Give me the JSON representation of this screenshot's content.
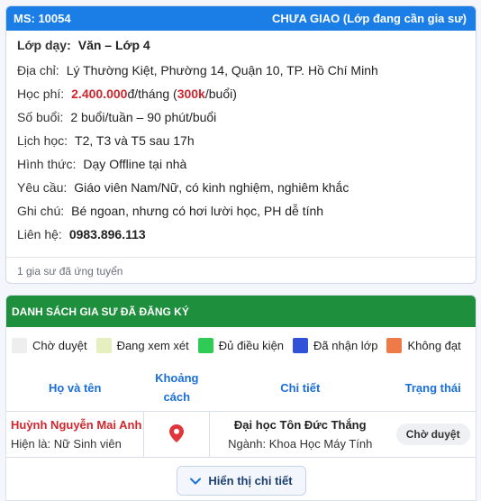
{
  "listing": {
    "code": "MS: 10054",
    "status": "CHƯA GIAO (Lớp đang cần gia sư)",
    "class_label": "Lớp dạy:",
    "class_value": "Văn – Lớp 4",
    "address_label": "Địa chỉ:",
    "address_value": "Lý Thường Kiệt, Phường 14, Quận 10, TP. Hồ Chí Minh",
    "fee_label": "Học phí:",
    "fee_amount": "2.400.000",
    "fee_unit": "đ/tháng (",
    "fee_session": "300k",
    "fee_session_unit": "/buổi)",
    "sessions_label": "Số buổi:",
    "sessions_value": "2 buổi/tuần – 90 phút/buổi",
    "schedule_label": "Lịch học:",
    "schedule_value": "T2, T3 và T5 sau 17h",
    "format_label": "Hình thức:",
    "format_value": "Dạy Offline tại nhà",
    "requirement_label": "Yêu cầu:",
    "requirement_value": "Giáo viên Nam/Nữ, có kinh nghiệm, nghiêm khắc",
    "note_label": "Ghi chú:",
    "note_value": "Bé ngoan, nhưng có hơi lười học, PH dễ tính",
    "contact_label": "Liên hệ:",
    "contact_value": "0983.896.113",
    "applicants_text": "1 gia sư đã ứng tuyển"
  },
  "tutor_list": {
    "title": "DANH SÁCH GIA SƯ ĐÃ ĐĂNG KÝ",
    "legend": [
      {
        "label": "Chờ duyệt",
        "color": "#eeeeee"
      },
      {
        "label": "Đang xem xét",
        "color": "#e6efc0"
      },
      {
        "label": "Đủ điều kiện",
        "color": "#2ecc55"
      },
      {
        "label": "Đã nhận lớp",
        "color": "#2f52d9"
      },
      {
        "label": "Không đạt",
        "color": "#ee7b47"
      }
    ],
    "columns": {
      "name": "Họ và tên",
      "distance_line1": "Khoảng",
      "distance_line2": "cách",
      "detail": "Chi tiết",
      "status": "Trạng thái"
    },
    "rows": [
      {
        "name": "Huỳnh Nguyễn Mai Anh",
        "current": "Hiện là: Nữ Sinh viên",
        "university": "Đại học Tôn Đức Thắng",
        "major": "Ngành: Khoa Học Máy Tính",
        "status": "Chờ duyệt"
      }
    ],
    "detail_button": "Hiển thị chi tiết"
  },
  "colors": {
    "header_blue": "#1a7ee6",
    "header_green": "#1e8f3d",
    "accent_red": "#d0262d",
    "accent_blue": "#1a6fd8"
  }
}
